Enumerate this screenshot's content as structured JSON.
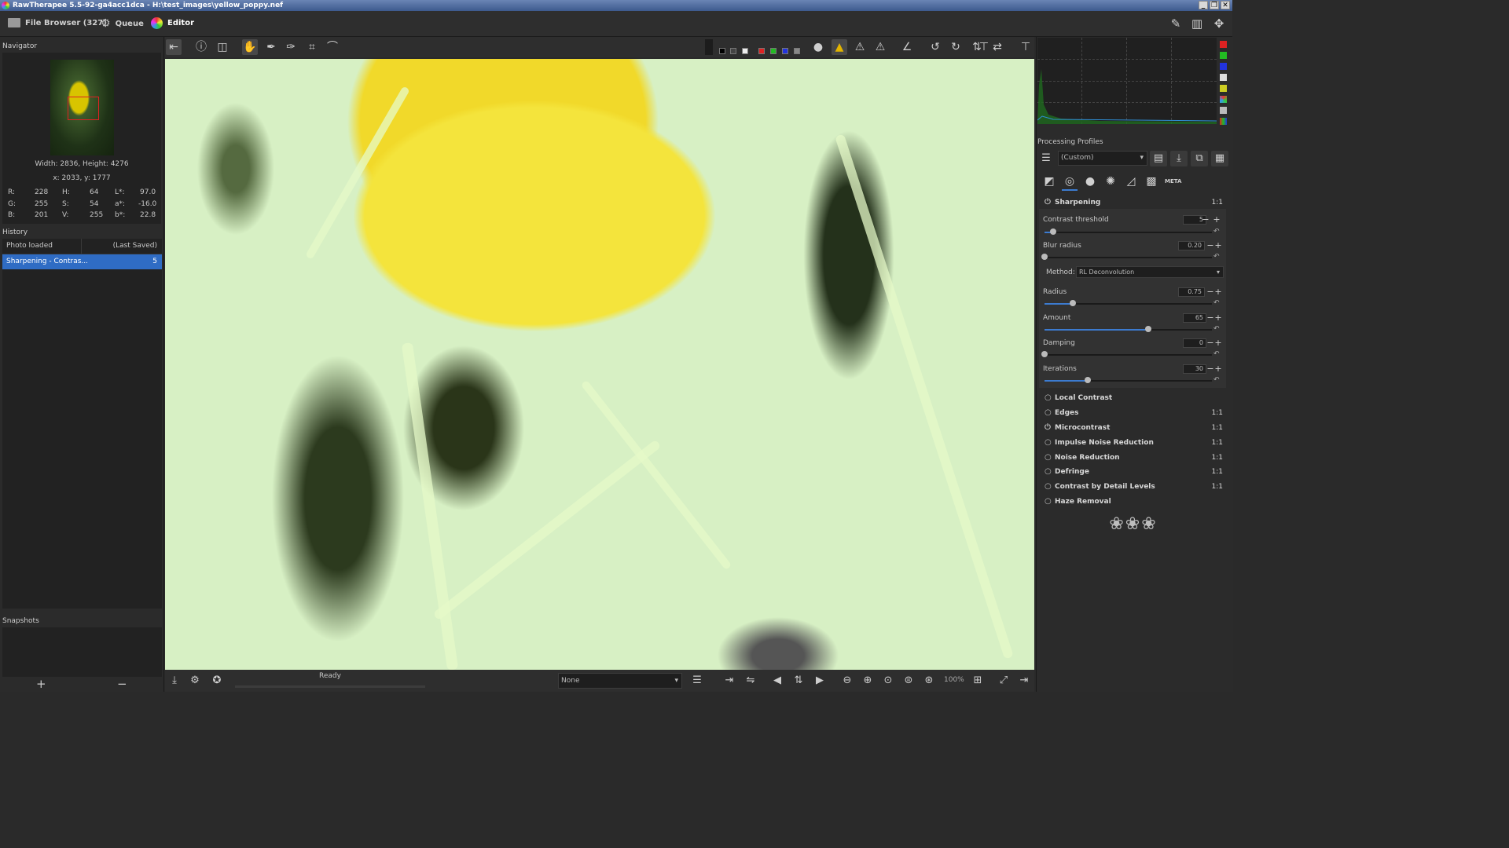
{
  "window": {
    "title": "RawTherapee 5.5-92-ga4acc1dca - H:\\test_images\\yellow_poppy.nef",
    "min": "_",
    "max": "❐",
    "close": "✕"
  },
  "tabs": {
    "file_browser": "File Browser (327)",
    "queue": "Queue",
    "editor": "Editor"
  },
  "navigator": {
    "title": "Navigator",
    "size": "Width: 2836, Height: 4276",
    "coords": "x: 2033, y: 1777",
    "values": {
      "r_label": "R:",
      "r": "228",
      "h_label": "H:",
      "h": "64",
      "l_label": "L*:",
      "l": "97.0",
      "g_label": "G:",
      "g": "255",
      "s_label": "S:",
      "s": "54",
      "a_label": "a*:",
      "a": "-16.0",
      "b_label": "B:",
      "b": "201",
      "v_label": "V:",
      "v": "255",
      "bb_label": "b*:",
      "bb": "22.8"
    }
  },
  "history": {
    "title": "History",
    "rows": [
      {
        "name": "Photo loaded",
        "value": "(Last Saved)"
      },
      {
        "name": "Sharpening - Contras...",
        "value": "5"
      }
    ]
  },
  "snapshots": {
    "title": "Snapshots",
    "add": "+",
    "remove": "−"
  },
  "status": {
    "text": "Ready",
    "zoom": "100%"
  },
  "bottom": {
    "combo_none": "None"
  },
  "right": {
    "processing_profiles_title": "Processing Profiles",
    "profile_value": "(Custom)",
    "meta_tab": "META",
    "sharpening": {
      "title": "Sharpening",
      "ratio": "1:1",
      "method_label": "Method:",
      "method_value": "RL Deconvolution",
      "controls": {
        "contrast_threshold": {
          "label": "Contrast threshold",
          "value": "5",
          "level": 0.05
        },
        "blur_radius": {
          "label": "Blur radius",
          "value": "0.20",
          "level": 0.0
        },
        "radius": {
          "label": "Radius",
          "value": "0.75",
          "level": 0.17
        },
        "amount": {
          "label": "Amount",
          "value": "65",
          "level": 0.62
        },
        "damping": {
          "label": "Damping",
          "value": "0",
          "level": 0.0
        },
        "iterations": {
          "label": "Iterations",
          "value": "30",
          "level": 0.26
        }
      }
    },
    "tools": [
      {
        "name": "Local Contrast",
        "ratio": ""
      },
      {
        "name": "Edges",
        "ratio": "1:1"
      },
      {
        "name": "Microcontrast",
        "ratio": "1:1"
      },
      {
        "name": "Impulse Noise Reduction",
        "ratio": "1:1"
      },
      {
        "name": "Noise Reduction",
        "ratio": "1:1"
      },
      {
        "name": "Defringe",
        "ratio": "1:1"
      },
      {
        "name": "Contrast by Detail Levels",
        "ratio": "1:1"
      },
      {
        "name": "Haze Removal",
        "ratio": ""
      }
    ],
    "footer_ornament": "❀❀❀"
  },
  "colors": {
    "selection": "#2f6cc4",
    "slider_fill": "#3c7bd0",
    "title_bar": "#3d5a8e"
  }
}
